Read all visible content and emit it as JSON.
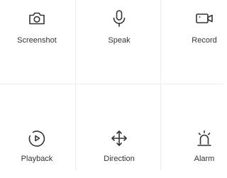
{
  "controls": {
    "row1": [
      {
        "label": "Screenshot",
        "icon": "camera-icon"
      },
      {
        "label": "Speak",
        "icon": "microphone-icon"
      },
      {
        "label": "Record",
        "icon": "video-camera-icon"
      }
    ],
    "row2": [
      {
        "label": "Playback",
        "icon": "playback-icon"
      },
      {
        "label": "Direction",
        "icon": "move-arrows-icon"
      },
      {
        "label": "Alarm",
        "icon": "siren-icon"
      }
    ]
  },
  "colors": {
    "icon": "#333333",
    "text": "#333333",
    "divider": "#eeeeee",
    "background": "#ffffff"
  }
}
